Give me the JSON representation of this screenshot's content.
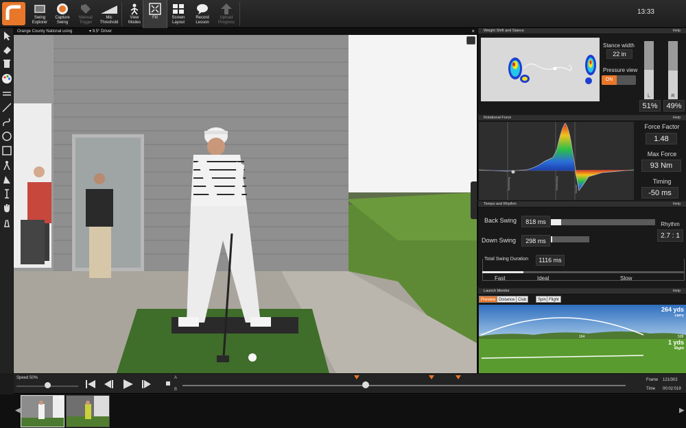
{
  "toolbar": {
    "buttons": [
      {
        "label": "Swing\nExplorer",
        "icon": "folder-icon"
      },
      {
        "label": "Capture\nSwing",
        "icon": "record-icon"
      },
      {
        "label": "Manual\nTrigger",
        "icon": "tag-icon"
      },
      {
        "label": "Mic\nThreshold",
        "icon": "slope-icon"
      },
      {
        "label": "View\nModes",
        "icon": "person-icon"
      },
      {
        "label": "Fill",
        "icon": "fill-icon"
      },
      {
        "label": "Screen\nLayout",
        "icon": "grid-icon"
      },
      {
        "label": "Record\nLesson",
        "icon": "chat-icon"
      },
      {
        "label": "Upload\nProgress",
        "icon": "upload-icon"
      }
    ],
    "clock": "13:33"
  },
  "video": {
    "location": "Orange County National using",
    "club": "9.5° Driver",
    "close": "×"
  },
  "weight_shift": {
    "title": "Weight Shift and Stance",
    "help": "Help",
    "stance_width_label": "Stance width",
    "stance_width_value": "22 in",
    "pressure_view_label": "Pressure view",
    "pressure_toggle": "ON",
    "left_letter": "L",
    "right_letter": "R",
    "left_pct": "51%",
    "right_pct": "49%",
    "left_level": 0.51,
    "right_level": 0.49
  },
  "rotational_force": {
    "title": "Rotational Force",
    "help": "Help",
    "marker_labels": [
      "Backswing",
      "Downswing",
      "Impact"
    ],
    "force_factor_label": "Force Factor",
    "force_factor_value": "1.48",
    "max_force_label": "Max Force",
    "max_force_value": "93 Nm",
    "timing_label": "Timing",
    "timing_value": "-50 ms"
  },
  "tempo": {
    "title": "Tempo and Rhythm",
    "help": "Help",
    "back_swing_label": "Back Swing",
    "back_swing_value": "818 ms",
    "back_swing_fill": 0.1,
    "down_swing_label": "Down Swing",
    "down_swing_value": "298 ms",
    "down_swing_fill": 0.04,
    "rhythm_label": "Rhythm",
    "rhythm_value": "2.7 : 1",
    "total_label": "Total Swing Duration",
    "total_value": "1116 ms",
    "scale": [
      "Fast",
      "Ideal",
      "Slow"
    ]
  },
  "launch_monitor": {
    "title": "Launch Monitor",
    "help": "Help",
    "tabs": [
      "Preview",
      "Distance",
      "Club Path",
      "Spin",
      "Flight"
    ],
    "active_tab": "Preview",
    "carry_value": "264 yds",
    "carry_label": "carry",
    "side_value": "1 yds",
    "side_label": "Right",
    "apex_label": "164",
    "left_tick": "0",
    "right_tick": "528"
  },
  "playback": {
    "speed_label": "Speed 50%",
    "speed_level": 0.5,
    "ab_top": "A",
    "ab_bottom": "B",
    "frame_label": "Frame",
    "frame_value": "121/302",
    "time_label": "Time",
    "time_value": "00:02:019"
  },
  "thumbnails": [
    {
      "tag": "A",
      "selected": true
    },
    {
      "tag": "",
      "selected": false
    }
  ],
  "colors": {
    "accent": "#e8772a"
  }
}
